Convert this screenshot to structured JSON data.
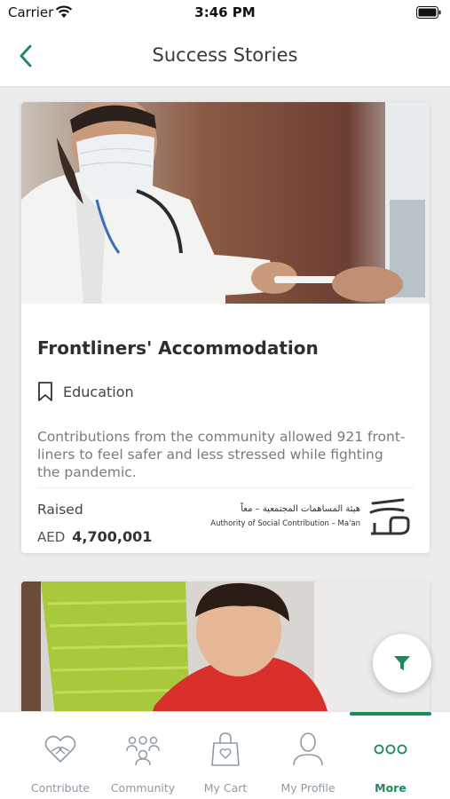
{
  "status_bar": {
    "carrier": "Carrier",
    "time": "3:46 PM"
  },
  "nav": {
    "title": "Success Stories",
    "back_icon": "chevron-left-icon"
  },
  "stories": [
    {
      "title": "Frontliners' Accommodation",
      "category": "Education",
      "category_icon": "bookmark-icon",
      "description": "Contributions from the community allowed 921 front-liners to feel safer and less stressed while fighting the pandemic.",
      "raised_label": "Raised",
      "currency": "AED",
      "amount": "4,700,001",
      "partner": {
        "name_ar": "هيئة المساهمات المجتمعية – معاً",
        "name_en": "Authority of Social Contribution – Ma'an"
      }
    }
  ],
  "filter_icon": "filter-icon",
  "tabs": [
    {
      "label": "Contribute",
      "icon": "heart-hands-icon",
      "active": false
    },
    {
      "label": "Community",
      "icon": "community-icon",
      "active": false
    },
    {
      "label": "My Cart",
      "icon": "shopping-bag-icon",
      "active": false
    },
    {
      "label": "My Profile",
      "icon": "profile-icon",
      "active": false
    },
    {
      "label": "More",
      "icon": "more-dots-icon",
      "active": true
    }
  ],
  "colors": {
    "accent": "#1e8a5a",
    "inactive": "#8f9aa5",
    "background": "#ececec"
  }
}
